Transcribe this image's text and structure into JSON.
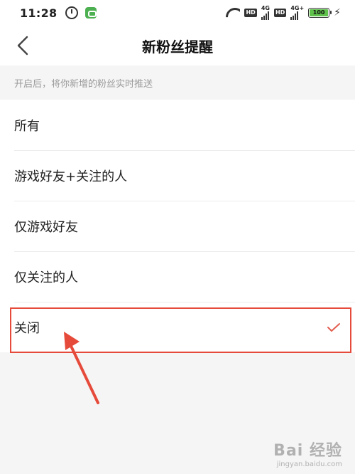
{
  "status_bar": {
    "time": "11:28",
    "hd1": "HD",
    "net1": "4G",
    "hd2": "HD",
    "net2": "4G+",
    "battery": "100"
  },
  "header": {
    "title": "新粉丝提醒",
    "back_icon": "chevron-left-icon"
  },
  "hint": "开启后，将你新增的粉丝实时推送",
  "options": [
    {
      "label": "所有",
      "selected": false
    },
    {
      "label": "游戏好友+关注的人",
      "selected": false
    },
    {
      "label": "仅游戏好友",
      "selected": false
    },
    {
      "label": "仅关注的人",
      "selected": false
    },
    {
      "label": "关闭",
      "selected": true
    }
  ],
  "colors": {
    "accent": "#e64a3b",
    "check": "#e35d4f"
  },
  "watermark": {
    "main": "Bai 经验",
    "sub": "jingyan.baidu.com"
  }
}
